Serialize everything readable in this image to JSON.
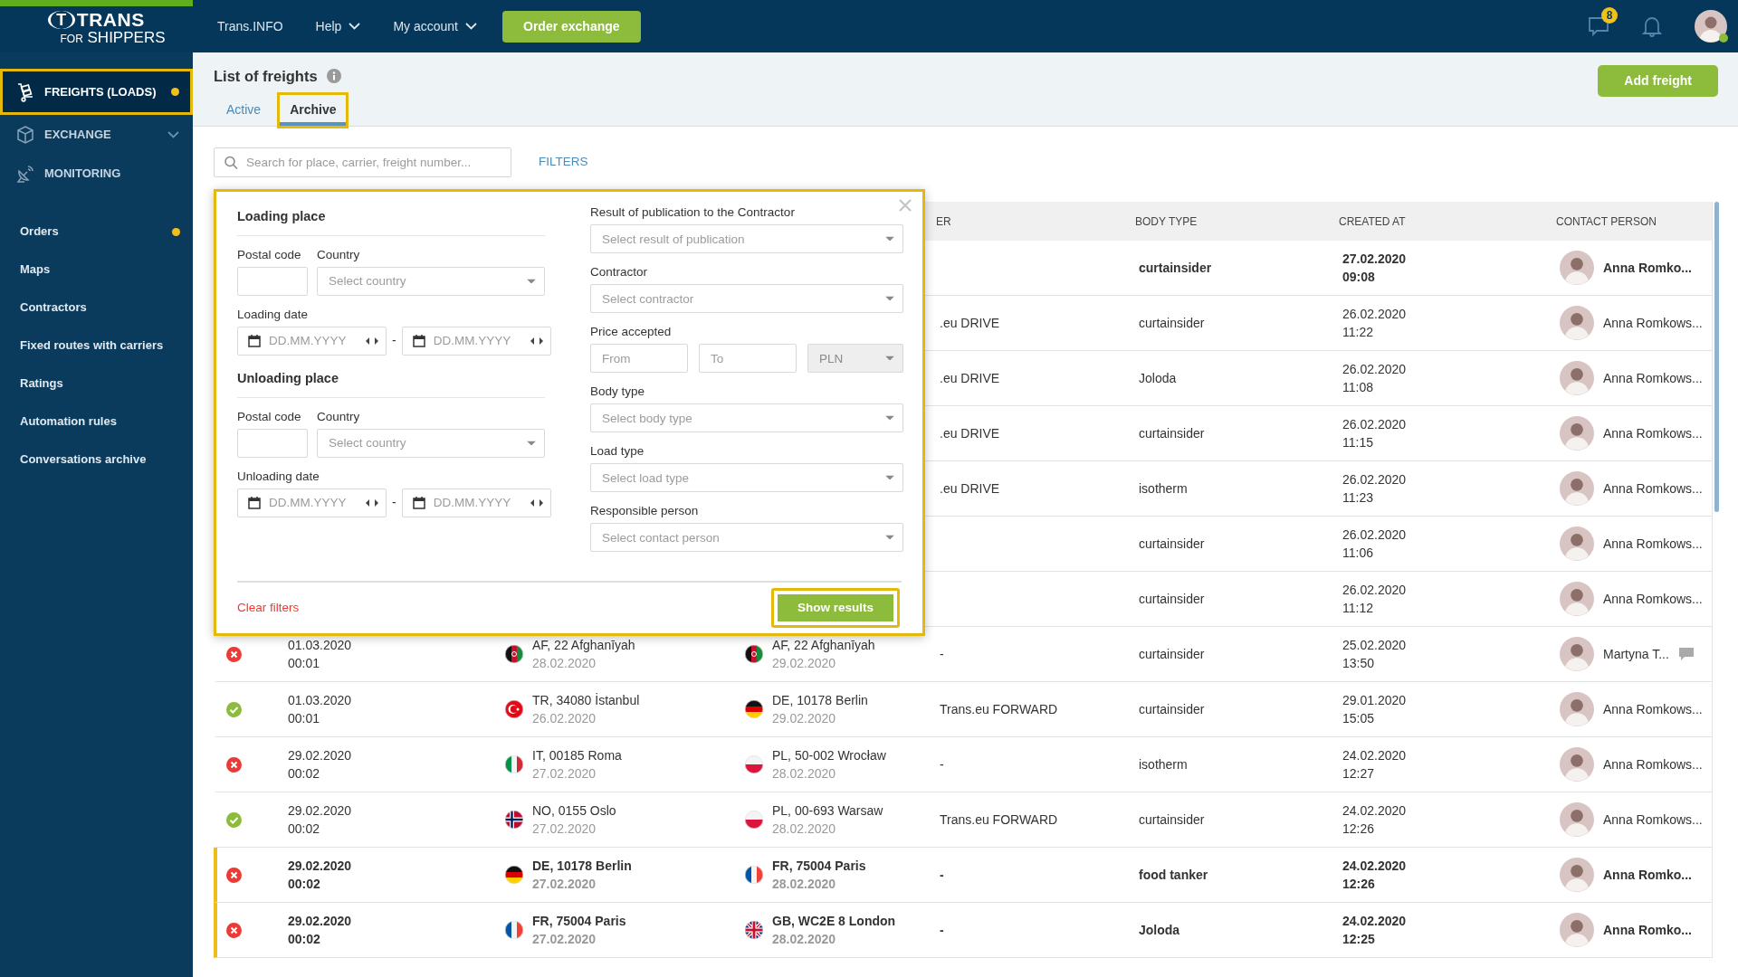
{
  "topbar": {
    "logo": {
      "mark": "T",
      "name": "TRANS",
      "tagline_prefix": "FOR",
      "tagline": "SHIPPERS"
    },
    "menu": [
      {
        "label": "Trans.INFO",
        "dropdown": false
      },
      {
        "label": "Help",
        "dropdown": true
      },
      {
        "label": "My account",
        "dropdown": true
      }
    ],
    "order_button": "Order exchange",
    "messages_badge": "8",
    "user": {
      "online": true
    }
  },
  "sidebar": {
    "modules": [
      {
        "label": "FREIGHTS (LOADS)",
        "selected": true,
        "dot": true,
        "highlighted": true,
        "expandable": false
      },
      {
        "label": "EXCHANGE",
        "selected": false,
        "dot": false,
        "highlighted": false,
        "expandable": true
      },
      {
        "label": "MONITORING",
        "selected": false,
        "dot": false,
        "highlighted": false,
        "expandable": false
      }
    ],
    "items": [
      {
        "label": "Orders",
        "dot": true
      },
      {
        "label": "Maps",
        "dot": false
      },
      {
        "label": "Contractors",
        "dot": false
      },
      {
        "label": "Fixed routes with carriers",
        "dot": false
      },
      {
        "label": "Ratings",
        "dot": false
      },
      {
        "label": "Automation rules",
        "dot": false
      },
      {
        "label": "Conversations archive",
        "dot": false
      }
    ]
  },
  "header": {
    "title": "List of freights",
    "add_button": "Add freight",
    "tabs": [
      {
        "label": "Active",
        "selected": false,
        "highlighted": false
      },
      {
        "label": "Archive",
        "selected": true,
        "highlighted": true
      }
    ]
  },
  "search": {
    "placeholder": "Search for place, carrier, freight number...",
    "filters_link": "FILTERS"
  },
  "filter_panel": {
    "highlighted": true,
    "sections": [
      {
        "title": "Loading place",
        "postal_label": "Postal code",
        "country_label": "Country",
        "country_placeholder": "Select country",
        "date_label": "Loading date",
        "date_from_placeholder": "DD.MM.YYYY",
        "separator": "-",
        "date_to_placeholder": "DD.MM.YYYY"
      },
      {
        "title": "Unloading place",
        "postal_label": "Postal code",
        "country_label": "Country",
        "country_placeholder": "Select country",
        "date_label": "Unloading date",
        "date_from_placeholder": "DD.MM.YYYY",
        "separator": "-",
        "date_to_placeholder": "DD.MM.YYYY"
      }
    ],
    "fields": [
      {
        "kind": "select",
        "label": "Result of publication to the Contractor",
        "placeholder": "Select result of publication"
      },
      {
        "kind": "select",
        "label": "Contractor",
        "placeholder": "Select contractor"
      },
      {
        "kind": "price",
        "label": "Price accepted",
        "from_placeholder": "From",
        "to_placeholder": "To",
        "currency": "PLN",
        "currency_disabled": true
      },
      {
        "kind": "select",
        "label": "Body type",
        "placeholder": "Select body type"
      },
      {
        "kind": "select",
        "label": "Load type",
        "placeholder": "Select load type"
      },
      {
        "kind": "select",
        "label": "Responsible person",
        "placeholder": "Select contact person"
      }
    ],
    "clear_link": "Clear filters",
    "submit": {
      "label": "Show results",
      "highlighted": true
    }
  },
  "table": {
    "columns": [
      "ER",
      "BODY TYPE",
      "CREATED AT",
      "CONTACT PERSON"
    ],
    "rows": [
      {
        "unread": true,
        "body_type": "curtainsider",
        "created_date": "27.02.2020",
        "created_time": "09:08",
        "contact": "Anna Romko...",
        "comment": false
      },
      {
        "unread": false,
        "carrier": ".eu DRIVE",
        "body_type": "curtainsider",
        "created_date": "26.02.2020",
        "created_time": "11:22",
        "contact": "Anna Romkows...",
        "comment": false
      },
      {
        "unread": false,
        "carrier": ".eu DRIVE",
        "body_type": "Joloda",
        "created_date": "26.02.2020",
        "created_time": "11:08",
        "contact": "Anna Romkows...",
        "comment": false
      },
      {
        "unread": false,
        "carrier": ".eu DRIVE",
        "body_type": "curtainsider",
        "created_date": "26.02.2020",
        "created_time": "11:15",
        "contact": "Anna Romkows...",
        "comment": false
      },
      {
        "unread": false,
        "carrier": ".eu DRIVE",
        "body_type": "isotherm",
        "created_date": "26.02.2020",
        "created_time": "11:23",
        "contact": "Anna Romkows...",
        "comment": false
      },
      {
        "unread": false,
        "body_type": "curtainsider",
        "created_date": "26.02.2020",
        "created_time": "11:06",
        "contact": "Anna Romkows...",
        "comment": false
      },
      {
        "unread": false,
        "body_type": "curtainsider",
        "created_date": "26.02.2020",
        "created_time": "11:12",
        "contact": "Anna Romkows...",
        "comment": false
      },
      {
        "unread": false,
        "accepted": false,
        "date": "01.03.2020",
        "time": "00:01",
        "loading": {
          "kind": "af",
          "place": "AF, 22 Afghanīyah",
          "date": "28.02.2020"
        },
        "unloading": {
          "kind": "af",
          "place": "AF, 22 Afghanīyah",
          "date": "29.02.2020"
        },
        "carrier": "-",
        "body_type": "curtainsider",
        "created_date": "25.02.2020",
        "created_time": "13:50",
        "contact": "Martyna T...",
        "comment": true
      },
      {
        "unread": false,
        "accepted": true,
        "date": "01.03.2020",
        "time": "00:01",
        "loading": {
          "kind": "tr",
          "place": "TR, 34080 İstanbul",
          "date": "26.02.2020"
        },
        "unloading": {
          "kind": "de",
          "place": "DE, 10178 Berlin",
          "date": "29.02.2020"
        },
        "carrier": "Trans.eu FORWARD",
        "body_type": "curtainsider",
        "created_date": "29.01.2020",
        "created_time": "15:05",
        "contact": "Anna Romkows...",
        "comment": false
      },
      {
        "unread": false,
        "accepted": false,
        "date": "29.02.2020",
        "time": "00:02",
        "loading": {
          "kind": "it",
          "place": "IT, 00185 Roma",
          "date": "27.02.2020"
        },
        "unloading": {
          "kind": "pl",
          "place": "PL, 50-002 Wrocław",
          "date": "28.02.2020"
        },
        "carrier": "-",
        "body_type": "isotherm",
        "created_date": "24.02.2020",
        "created_time": "12:27",
        "contact": "Anna Romkows...",
        "comment": false
      },
      {
        "unread": false,
        "accepted": true,
        "date": "29.02.2020",
        "time": "00:02",
        "loading": {
          "kind": "no",
          "place": "NO, 0155 Oslo",
          "date": "27.02.2020"
        },
        "unloading": {
          "kind": "pl",
          "place": "PL, 00-693 Warsaw",
          "date": "28.02.2020"
        },
        "carrier": "Trans.eu FORWARD",
        "body_type": "curtainsider",
        "created_date": "24.02.2020",
        "created_time": "12:26",
        "contact": "Anna Romkows...",
        "comment": false
      },
      {
        "unread": true,
        "accepted": false,
        "date": "29.02.2020",
        "time": "00:02",
        "loading": {
          "kind": "de",
          "place": "DE, 10178 Berlin",
          "date": "27.02.2020"
        },
        "unloading": {
          "kind": "fr",
          "place": "FR, 75004 Paris",
          "date": "28.02.2020"
        },
        "carrier": "-",
        "body_type": "food tanker",
        "created_date": "24.02.2020",
        "created_time": "12:26",
        "contact": "Anna Romko...",
        "comment": false
      },
      {
        "unread": true,
        "accepted": false,
        "date": "29.02.2020",
        "time": "00:02",
        "loading": {
          "kind": "fr",
          "place": "FR, 75004 Paris",
          "date": "27.02.2020"
        },
        "unloading": {
          "kind": "gb",
          "place": "GB, WC2E 8 London",
          "date": "28.02.2020"
        },
        "carrier": "-",
        "body_type": "Joloda",
        "created_date": "24.02.2020",
        "created_time": "12:25",
        "contact": "Anna Romko...",
        "comment": false
      }
    ]
  }
}
